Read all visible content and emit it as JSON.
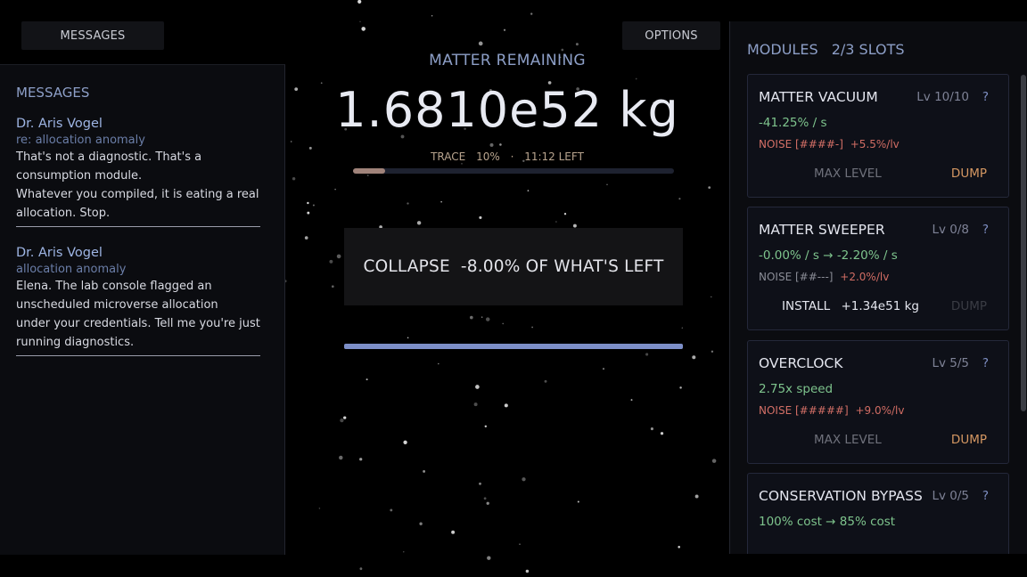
{
  "top": {
    "messages_button": "MESSAGES",
    "options_button": "OPTIONS"
  },
  "messages_panel": {
    "title": "MESSAGES",
    "items": [
      {
        "from": "Dr. Aris Vogel",
        "subject": "re: allocation anomaly",
        "lines": [
          "That's not a diagnostic. That's a",
          "consumption module.",
          "Whatever you compiled, it is eating a real",
          "allocation. Stop."
        ]
      },
      {
        "from": "Dr. Aris Vogel",
        "subject": "allocation anomaly",
        "lines": [
          "Elena. The lab console flagged an",
          "unscheduled microverse allocation",
          "under your credentials. Tell me you're just",
          "running diagnostics."
        ]
      }
    ]
  },
  "center": {
    "label": "MATTER REMAINING",
    "value": "1.6810e52 kg",
    "trace_label": "TRACE",
    "trace_percent": "10%",
    "trace_sep": "·",
    "time_left": "11:12 LEFT",
    "trace_fill": 0.1,
    "collapse_label": "COLLAPSE",
    "collapse_amount": "-8.00% OF WHAT'S LEFT",
    "collapse_progress": 1.0
  },
  "modules": {
    "title": "MODULES",
    "slots": "2/3 SLOTS",
    "cards": [
      {
        "name": "MATTER VACUUM",
        "level": "Lv 10/10",
        "help": "?",
        "rate": "-41.25% / s",
        "noise_label": "NOISE",
        "noise_bars": "[####-]",
        "noise_inc": "+5.5%/lv",
        "noise_hot": true,
        "action": "MAX LEVEL",
        "action_amount": "",
        "dump": "DUMP",
        "dump_enabled": true
      },
      {
        "name": "MATTER SWEEPER",
        "level": "Lv 0/8",
        "help": "?",
        "rate": "-0.00% / s  →  -2.20% / s",
        "noise_label": "NOISE",
        "noise_bars": "[##---]",
        "noise_inc": "+2.0%/lv",
        "noise_hot": false,
        "action": "INSTALL",
        "action_amount": "+1.34e51 kg",
        "dump": "DUMP",
        "dump_enabled": false
      },
      {
        "name": "OVERCLOCK",
        "level": "Lv 5/5",
        "help": "?",
        "rate": "2.75x speed",
        "noise_label": "NOISE",
        "noise_bars": "[#####]",
        "noise_inc": "+9.0%/lv",
        "noise_hot": true,
        "action": "MAX LEVEL",
        "action_amount": "",
        "dump": "DUMP",
        "dump_enabled": true
      },
      {
        "name": "CONSERVATION BYPASS",
        "level": "Lv 0/5",
        "help": "?",
        "rate": "100% cost  →  85% cost",
        "noise_label": "",
        "noise_bars": "",
        "noise_inc": "",
        "noise_hot": false,
        "action": "",
        "action_amount": "",
        "dump": "",
        "dump_enabled": false
      }
    ]
  },
  "colors": {
    "accent": "#8d9fc7",
    "positive": "#7ec48d",
    "danger": "#d36f66",
    "dump": "#d49762"
  }
}
